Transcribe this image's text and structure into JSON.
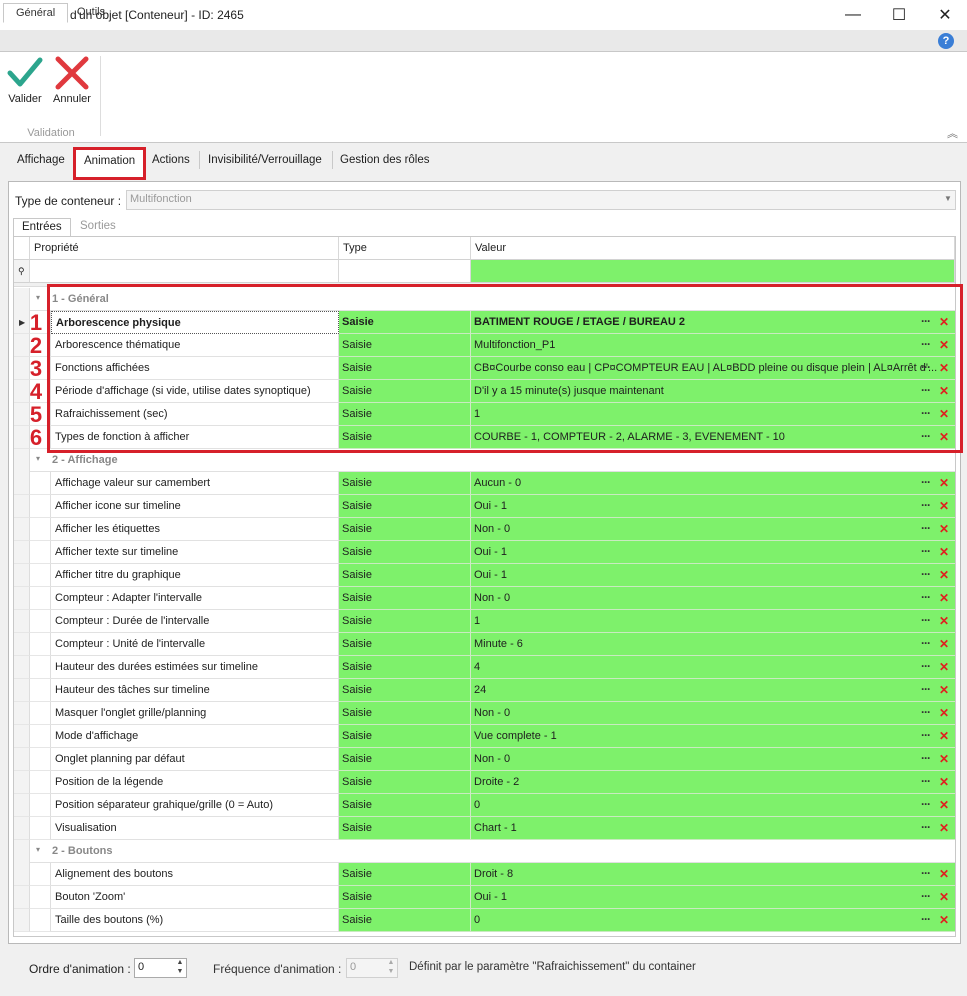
{
  "window": {
    "title": "Edition d'un objet [Conteneur] - ID: 2465",
    "minimize": "—",
    "maximize": "☐",
    "close": "✕"
  },
  "ribbon": {
    "tabs": [
      "Général",
      "Outils"
    ],
    "help": "?",
    "buttons": {
      "validate": "Valider",
      "cancel": "Annuler"
    },
    "group_label": "Validation",
    "collapse": "︽"
  },
  "main_tabs": [
    "Affichage",
    "Animation",
    "Actions",
    "Invisibilité/Verrouillage",
    "Gestion des rôles"
  ],
  "container_type": {
    "label": "Type de conteneur :",
    "value": "Multifonction",
    "arrow": "▼"
  },
  "inner_tabs": [
    "Entrées",
    "Sorties"
  ],
  "grid": {
    "columns": {
      "property": "Propriété",
      "type": "Type",
      "value": "Valeur"
    },
    "filter_icon": "⚲",
    "groups": [
      {
        "label": "1 - Général",
        "rows": [
          {
            "n": "1",
            "prop": "Arborescence physique",
            "type": "Saisie",
            "value": "BATIMENT ROUGE / ETAGE / BUREAU 2"
          },
          {
            "n": "2",
            "prop": "Arborescence thématique",
            "type": "Saisie",
            "value": "Multifonction_P1"
          },
          {
            "n": "3",
            "prop": "Fonctions affichées",
            "type": "Saisie",
            "value": "CB¤Courbe conso eau | CP¤COMPTEUR EAU | AL¤BDD pleine ou disque plein | AL¤Arrêt d'..."
          },
          {
            "n": "4",
            "prop": "Période d'affichage (si vide, utilise dates synoptique)",
            "type": "Saisie",
            "value": "D'il y a 15 minute(s) jusque maintenant"
          },
          {
            "n": "5",
            "prop": "Rafraichissement (sec)",
            "type": "Saisie",
            "value": "1"
          },
          {
            "n": "6",
            "prop": "Types de fonction à afficher",
            "type": "Saisie",
            "value": "COURBE - 1, COMPTEUR - 2, ALARME - 3, EVENEMENT - 10"
          }
        ]
      },
      {
        "label": "2 - Affichage",
        "rows": [
          {
            "prop": "Affichage valeur sur camembert",
            "type": "Saisie",
            "value": "Aucun - 0"
          },
          {
            "prop": "Afficher icone sur timeline",
            "type": "Saisie",
            "value": "Oui - 1"
          },
          {
            "prop": "Afficher les étiquettes",
            "type": "Saisie",
            "value": "Non - 0"
          },
          {
            "prop": "Afficher texte sur timeline",
            "type": "Saisie",
            "value": "Oui - 1"
          },
          {
            "prop": "Afficher titre du graphique",
            "type": "Saisie",
            "value": "Oui - 1"
          },
          {
            "prop": "Compteur : Adapter l'intervalle",
            "type": "Saisie",
            "value": "Non - 0"
          },
          {
            "prop": "Compteur : Durée de l'intervalle",
            "type": "Saisie",
            "value": "1"
          },
          {
            "prop": "Compteur : Unité de l'intervalle",
            "type": "Saisie",
            "value": "Minute - 6"
          },
          {
            "prop": "Hauteur des durées estimées sur timeline",
            "type": "Saisie",
            "value": "4"
          },
          {
            "prop": "Hauteur des tâches sur timeline",
            "type": "Saisie",
            "value": "24"
          },
          {
            "prop": "Masquer l'onglet grille/planning",
            "type": "Saisie",
            "value": "Non - 0"
          },
          {
            "prop": "Mode d'affichage",
            "type": "Saisie",
            "value": "Vue complete - 1"
          },
          {
            "prop": "Onglet planning par défaut",
            "type": "Saisie",
            "value": "Non - 0"
          },
          {
            "prop": "Position de la légende",
            "type": "Saisie",
            "value": "Droite - 2"
          },
          {
            "prop": "Position séparateur grahique/grille (0 = Auto)",
            "type": "Saisie",
            "value": "0"
          },
          {
            "prop": "Visualisation",
            "type": "Saisie",
            "value": "Chart - 1"
          }
        ]
      },
      {
        "label": "2 - Boutons",
        "rows": [
          {
            "prop": "Alignement des boutons",
            "type": "Saisie",
            "value": "Droit - 8"
          },
          {
            "prop": "Bouton 'Zoom'",
            "type": "Saisie",
            "value": "Oui - 1"
          },
          {
            "prop": "Taille des boutons (%)",
            "type": "Saisie",
            "value": "0"
          }
        ]
      }
    ],
    "row_actions": {
      "more": "···",
      "delete": "✕"
    }
  },
  "footer": {
    "order_label": "Ordre d'animation :",
    "order_value": "0",
    "freq_label": "Fréquence d'animation :",
    "freq_value": "0",
    "freq_note": "Définit par le paramètre \"Rafraichissement\" du container"
  },
  "colors": {
    "value_bg": "#7ef16b",
    "highlight_red": "#d6202a",
    "validate_green": "#2ca58d",
    "cancel_red": "#e0393e"
  }
}
